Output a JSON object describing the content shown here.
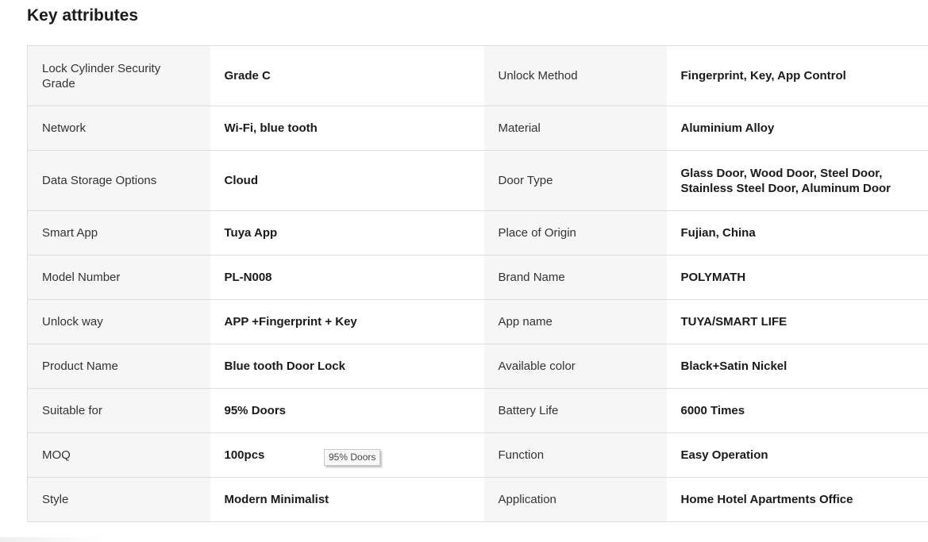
{
  "section": {
    "title": "Key attributes"
  },
  "attributes": {
    "rows": [
      {
        "l1": "Lock Cylinder Security Grade",
        "v1": "Grade C",
        "l2": "Unlock Method",
        "v2": "Fingerprint, Key, App Control"
      },
      {
        "l1": "Network",
        "v1": "Wi-Fi, blue tooth",
        "l2": "Material",
        "v2": "Aluminium Alloy"
      },
      {
        "l1": "Data Storage Options",
        "v1": "Cloud",
        "l2": "Door Type",
        "v2": "Glass Door, Wood Door, Steel Door, Stainless Steel Door, Aluminum Door"
      },
      {
        "l1": "Smart App",
        "v1": "Tuya App",
        "l2": "Place of Origin",
        "v2": "Fujian, China"
      },
      {
        "l1": "Model Number",
        "v1": "PL-N008",
        "l2": "Brand Name",
        "v2": "POLYMATH"
      },
      {
        "l1": "Unlock way",
        "v1": "APP +Fingerprint + Key",
        "l2": "App name",
        "v2": "TUYA/SMART LIFE"
      },
      {
        "l1": "Product Name",
        "v1": "Blue tooth Door Lock",
        "l2": "Available color",
        "v2": "Black+Satin Nickel"
      },
      {
        "l1": "Suitable for",
        "v1": "95% Doors",
        "l2": "Battery Life",
        "v2": "6000 Times"
      },
      {
        "l1": "MOQ",
        "v1": "100pcs",
        "l2": "Function",
        "v2": "Easy Operation"
      },
      {
        "l1": "Style",
        "v1": "Modern Minimalist",
        "l2": "Application",
        "v2": "Home Hotel Apartments Office"
      }
    ]
  },
  "tooltip": {
    "text": "95% Doors"
  }
}
